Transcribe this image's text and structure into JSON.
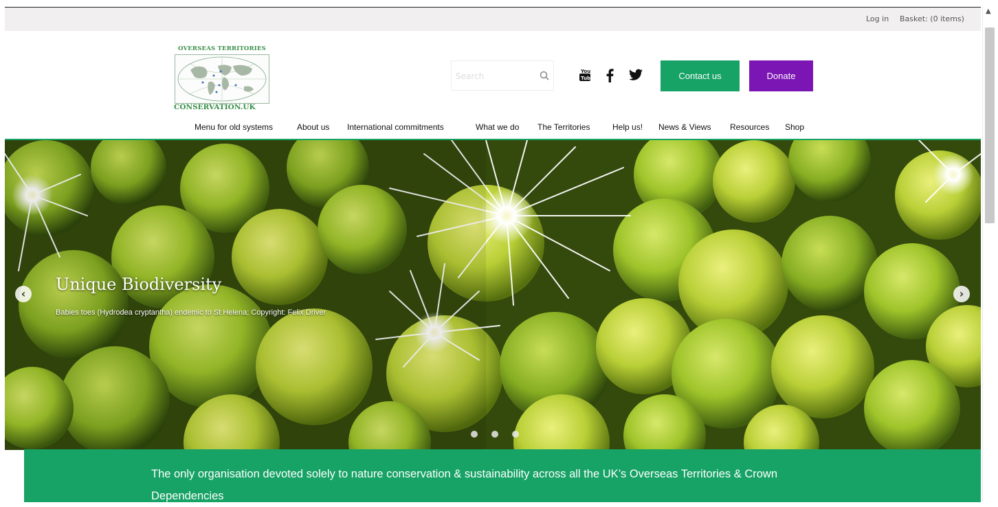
{
  "topbar": {
    "login": "Log in",
    "basket": "Basket: (0 items)"
  },
  "logo": {
    "top_text": "OVERSEAS TERRITORIES",
    "bottom_text": "CONSERVATION.UK"
  },
  "search": {
    "placeholder": "Search"
  },
  "social": [
    "youtube-icon",
    "facebook-icon",
    "twitter-icon"
  ],
  "buttons": {
    "contact": "Contact us",
    "donate": "Donate"
  },
  "nav": {
    "items": [
      "Menu for old systems",
      "About us",
      "International commitments",
      "What we do",
      "The Territories",
      "Help us!",
      "News & Views",
      "Resources",
      "Shop"
    ]
  },
  "hero": {
    "title": "Unique Biodiversity",
    "caption": "Babies toes (Hydrodea cryptantha) endemic to St Helena; Copyright: Felix Driver",
    "slides": 3,
    "active_slide": 1
  },
  "band": {
    "text": "The only organisation devoted solely to nature conservation & sustainability across all the UK’s Overseas Territories & Crown Dependencies"
  },
  "colors": {
    "green": "#17a266",
    "purple": "#7b15b3",
    "topbar_bg": "#f1efef"
  }
}
